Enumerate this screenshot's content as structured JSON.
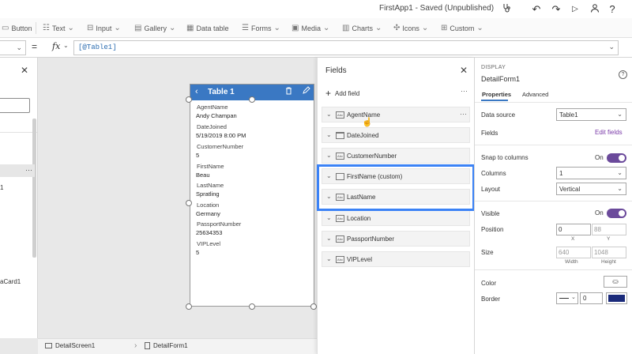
{
  "app": {
    "title": "FirstApp1 - Saved (Unpublished)"
  },
  "titlebar_icons": [
    "stethoscope-icon",
    "undo-icon",
    "redo-icon",
    "play-icon",
    "person-icon",
    "help-icon"
  ],
  "ribbon": {
    "items": [
      {
        "name": "button",
        "label": "Button",
        "icon": "button-icon"
      },
      {
        "name": "text",
        "label": "Text",
        "icon": "text-icon"
      },
      {
        "name": "input",
        "label": "Input",
        "icon": "input-icon"
      },
      {
        "name": "gallery",
        "label": "Gallery",
        "icon": "gallery-icon"
      },
      {
        "name": "data-table",
        "label": "Data table",
        "icon": "table-icon"
      },
      {
        "name": "forms",
        "label": "Forms",
        "icon": "forms-icon"
      },
      {
        "name": "media",
        "label": "Media",
        "icon": "media-icon"
      },
      {
        "name": "charts",
        "label": "Charts",
        "icon": "chart-icon"
      },
      {
        "name": "icons",
        "label": "Icons",
        "icon": "icons-icon"
      },
      {
        "name": "custom",
        "label": "Custom",
        "icon": "custom-icon"
      }
    ]
  },
  "formula": {
    "eq": "=",
    "fx": "fx",
    "value": "[@Table1]"
  },
  "left_panel": {
    "row_label": "1",
    "card_label": "aCard1"
  },
  "bottom_bar": {
    "screen": "DetailScreen1",
    "form": "DetailForm1"
  },
  "form": {
    "title": "Table 1",
    "fields": [
      {
        "label": "AgentName",
        "value": "Andy Champan"
      },
      {
        "label": "DateJoined",
        "value": "5/19/2019 8:00 PM"
      },
      {
        "label": "CustomerNumber",
        "value": "5"
      },
      {
        "label": "FirstName",
        "value": "Beau"
      },
      {
        "label": "LastName",
        "value": "Spratling"
      },
      {
        "label": "Location",
        "value": "Germany"
      },
      {
        "label": "PassportNumber",
        "value": "25634353"
      },
      {
        "label": "VIPLevel",
        "value": "5"
      }
    ]
  },
  "fields_pane": {
    "title": "Fields",
    "add_label": "Add field",
    "items": [
      {
        "name": "AgentName",
        "type": "Abc"
      },
      {
        "name": "DateJoined",
        "type": "cal"
      },
      {
        "name": "CustomerNumber",
        "type": "Abc"
      },
      {
        "name": "FirstName (custom)",
        "type": "box"
      },
      {
        "name": "LastName",
        "type": "Abc"
      },
      {
        "name": "Location",
        "type": "Abc"
      },
      {
        "name": "PassportNumber",
        "type": "Abc"
      },
      {
        "name": "VIPLevel",
        "type": "Abc"
      }
    ],
    "highlight_color": "#3b82f6"
  },
  "right_panel": {
    "section": "DISPLAY",
    "control_name": "DetailForm1",
    "help": "?",
    "tabs": [
      "Properties",
      "Advanced"
    ],
    "data_source": {
      "label": "Data source",
      "value": "Table1"
    },
    "fields": {
      "label": "Fields",
      "link": "Edit fields"
    },
    "snap": {
      "label": "Snap to columns",
      "state": "On"
    },
    "columns": {
      "label": "Columns",
      "value": "1"
    },
    "layout": {
      "label": "Layout",
      "value": "Vertical"
    },
    "visible": {
      "label": "Visible",
      "state": "On"
    },
    "position": {
      "label": "Position",
      "x": "0",
      "y": "88",
      "x_cap": "X",
      "y_cap": "Y"
    },
    "size": {
      "label": "Size",
      "width": "640",
      "height": "1048",
      "w_cap": "Width",
      "h_cap": "Height"
    },
    "color": {
      "label": "Color"
    },
    "border": {
      "label": "Border",
      "width": "0",
      "color": "#1a2a7a"
    },
    "accent": "#6b4a9b"
  }
}
